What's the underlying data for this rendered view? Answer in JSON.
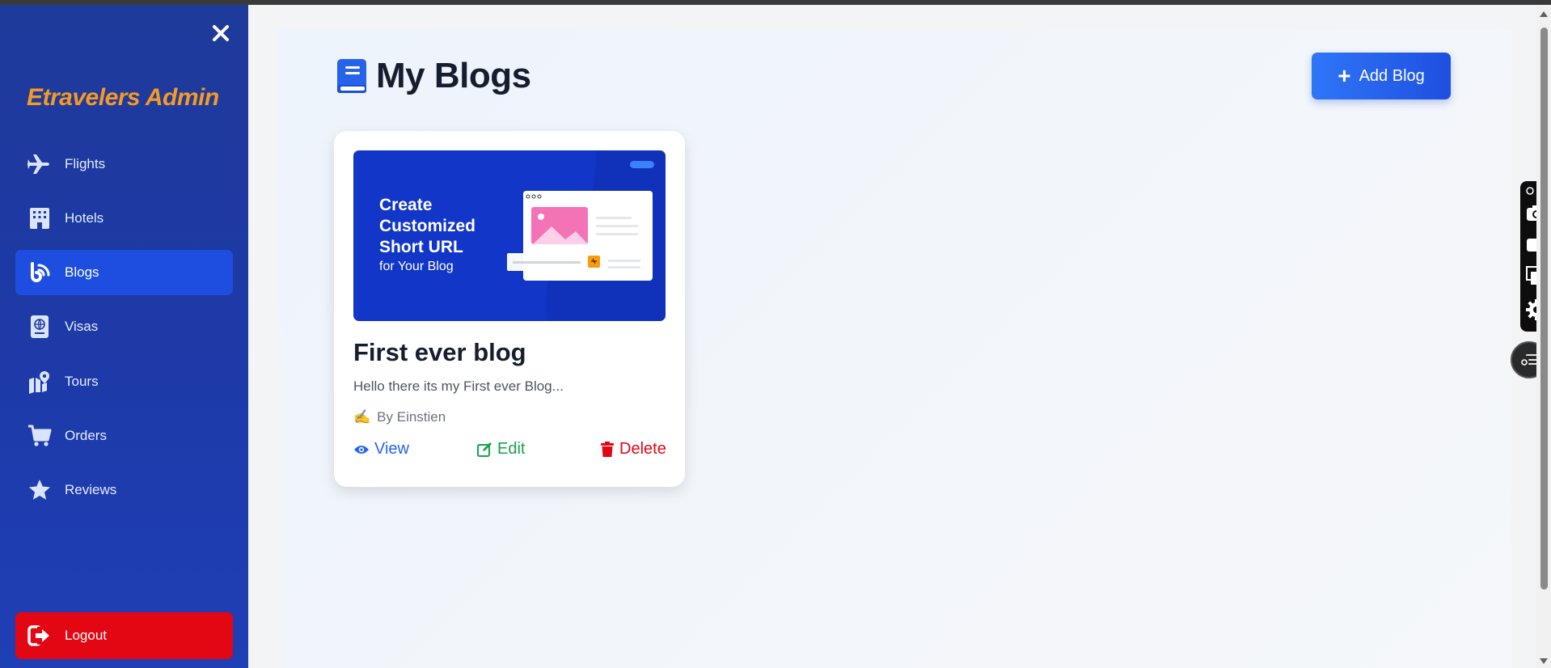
{
  "sidebar": {
    "brand": "Etravelers Admin",
    "items": [
      {
        "label": "Flights",
        "icon": "plane-icon"
      },
      {
        "label": "Hotels",
        "icon": "building-icon"
      },
      {
        "label": "Blogs",
        "icon": "blog-icon",
        "active": true
      },
      {
        "label": "Visas",
        "icon": "passport-icon"
      },
      {
        "label": "Tours",
        "icon": "map-location-icon"
      },
      {
        "label": "Orders",
        "icon": "cart-icon"
      },
      {
        "label": "Reviews",
        "icon": "star-icon"
      }
    ],
    "logout": "Logout"
  },
  "main": {
    "title": "My Blogs",
    "add_button": "Add Blog",
    "blogs": [
      {
        "thumbnail": {
          "line1": "Create",
          "line2": "Customized",
          "line3": "Short URL",
          "line4": "for Your Blog"
        },
        "title": "First ever blog",
        "excerpt": "Hello there its my First ever Blog...",
        "author_icon": "✍️",
        "author": "By Einstien",
        "actions": {
          "view": "View",
          "edit": "Edit",
          "delete": "Delete"
        }
      }
    ]
  },
  "colors": {
    "sidebar": "#1e3a9a",
    "brand": "#f59a23",
    "active": "#1e4ee0",
    "logout": "#e30613",
    "view": "#2563eb",
    "edit": "#16a34a",
    "delete": "#e30613"
  }
}
